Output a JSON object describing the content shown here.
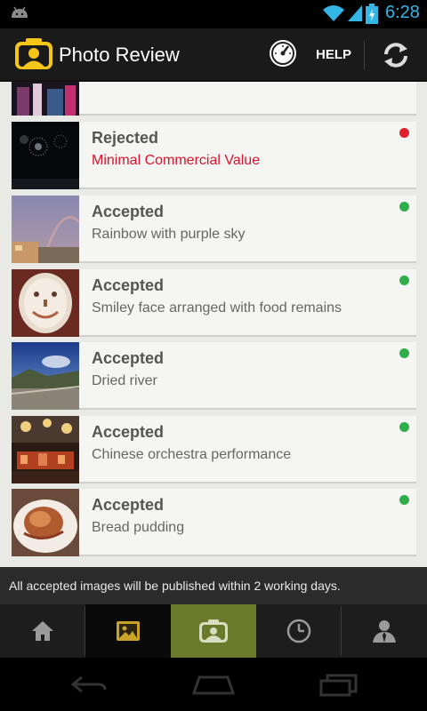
{
  "status_bar": {
    "time": "6:28"
  },
  "app_bar": {
    "title": "Photo Review",
    "help_label": "HELP"
  },
  "photos": [
    {
      "status": "",
      "description": "",
      "status_color": "",
      "thumb": "partial"
    },
    {
      "status": "Rejected",
      "description": "Minimal Commercial Value",
      "status_color": "#e0202c",
      "thumb": "fireworks"
    },
    {
      "status": "Accepted",
      "description": "Rainbow with purple sky",
      "status_color": "#2fae4a",
      "thumb": "rainbow"
    },
    {
      "status": "Accepted",
      "description": "Smiley face arranged with food remains",
      "status_color": "#2fae4a",
      "thumb": "plate"
    },
    {
      "status": "Accepted",
      "description": "Dried river",
      "status_color": "#2fae4a",
      "thumb": "river"
    },
    {
      "status": "Accepted",
      "description": "Chinese orchestra performance",
      "status_color": "#2fae4a",
      "thumb": "orchestra"
    },
    {
      "status": "Accepted",
      "description": "Bread pudding",
      "status_color": "#2fae4a",
      "thumb": "pudding"
    }
  ],
  "info_message": "All accepted images will be published within 2 working days.",
  "tabs": [
    {
      "icon": "home-icon"
    },
    {
      "icon": "gallery-icon"
    },
    {
      "icon": "photo-review-icon"
    },
    {
      "icon": "history-icon"
    },
    {
      "icon": "profile-icon"
    }
  ]
}
